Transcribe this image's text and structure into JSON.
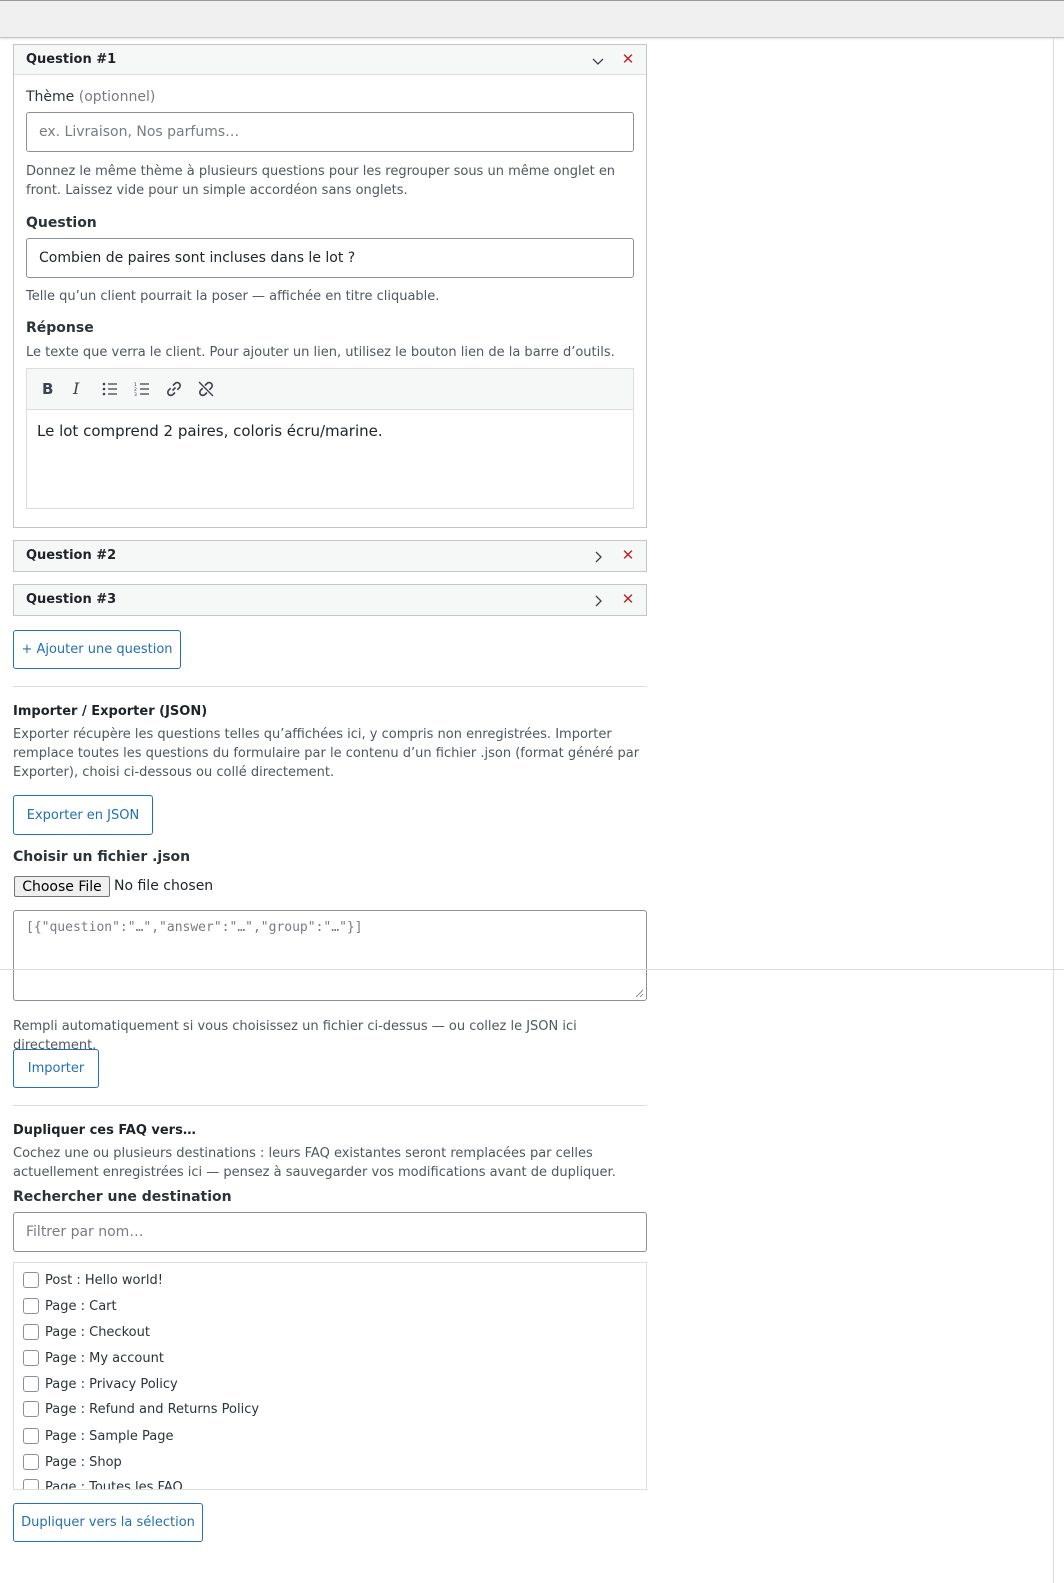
{
  "questions": [
    {
      "title": "Question #1",
      "theme_label": "Thème",
      "theme_optional": "(optionnel)",
      "theme_placeholder": "ex. Livraison, Nos parfums…",
      "theme_help": "Donnez le même thème à plusieurs questions pour les regrouper sous un même onglet en front. Laissez vide pour un simple accordéon sans onglets.",
      "question_label": "Question",
      "question_value": "Combien de paires sont incluses dans le lot ?",
      "question_help": "Telle qu’un client pourrait la poser — affichée en titre cliquable.",
      "answer_label": "Réponse",
      "answer_help": "Le texte que verra le client. Pour ajouter un lien, utilisez le bouton lien de la barre d’outils.",
      "answer_value": "Le lot comprend 2 paires, coloris écru/marine."
    },
    {
      "title": "Question #2"
    },
    {
      "title": "Question #3"
    }
  ],
  "add_question_label": "+ Ajouter une question",
  "import_export": {
    "title": "Importer / Exporter (JSON)",
    "help": "Exporter récupère les questions telles qu’affichées ici, y compris non enregistrées. Importer remplace toutes les questions du formulaire par le contenu d’un fichier .json (format généré par Exporter), choisi ci-dessous ou collé directement.",
    "export_label": "Exporter en JSON",
    "file_label": "Choisir un fichier .json",
    "choose_file": "Choose File",
    "no_file": "No file chosen",
    "textarea_placeholder": "[{\"question\":\"…\",\"answer\":\"…\",\"group\":\"…\"}]",
    "auto_help": "Rempli automatiquement si vous choisissez un fichier ci-dessus — ou collez le JSON ici directement.",
    "import_label": "Importer"
  },
  "duplicate": {
    "title": "Dupliquer ces FAQ vers…",
    "help": "Cochez une ou plusieurs destinations : leurs FAQ existantes seront remplacées par celles actuellement enregistrées ici — pensez à sauvegarder vos modifications avant de dupliquer.",
    "search_label": "Rechercher une destination",
    "search_placeholder": "Filtrer par nom…",
    "destinations": [
      "Post : Hello world!",
      "Page : Cart",
      "Page : Checkout",
      "Page : My account",
      "Page : Privacy Policy",
      "Page : Refund and Returns Policy",
      "Page : Sample Page",
      "Page : Shop",
      "Page : Toutes les FAQ"
    ],
    "button_label": "Dupliquer vers la sélection"
  },
  "colors": {
    "accent": "#2271b1",
    "danger": "#b32d2e",
    "border": "#c3c4c7"
  },
  "icons": [
    "chevron-down-icon",
    "chevron-right-icon",
    "close-icon",
    "bold-icon",
    "italic-icon",
    "bullet-list-icon",
    "numbered-list-icon",
    "link-icon",
    "unlink-icon"
  ]
}
